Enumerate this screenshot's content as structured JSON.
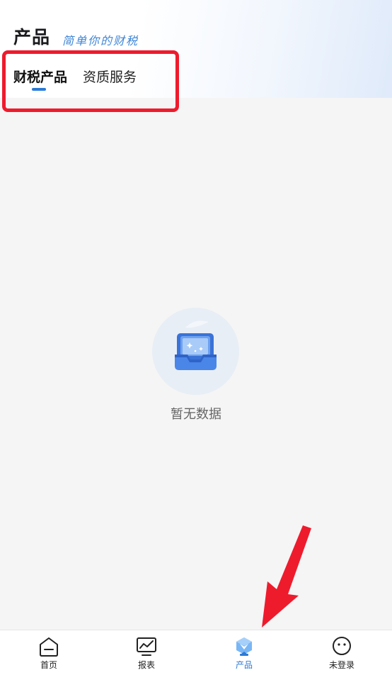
{
  "header": {
    "title": "产品",
    "slogan": "简单你的财税"
  },
  "tabs": [
    {
      "label": "财税产品",
      "active": true
    },
    {
      "label": "资质服务",
      "active": false
    }
  ],
  "empty_state": {
    "message": "暂无数据",
    "icon": "empty-inbox-icon"
  },
  "bottom_nav": [
    {
      "label": "首页",
      "icon": "home-icon",
      "active": false
    },
    {
      "label": "报表",
      "icon": "chart-icon",
      "active": false
    },
    {
      "label": "产品",
      "icon": "product-icon",
      "active": true
    },
    {
      "label": "未登录",
      "icon": "face-icon",
      "active": false
    }
  ],
  "colors": {
    "accent": "#2b7ad6",
    "annotation": "#ee1b2d",
    "background": "#f5f5f5"
  }
}
